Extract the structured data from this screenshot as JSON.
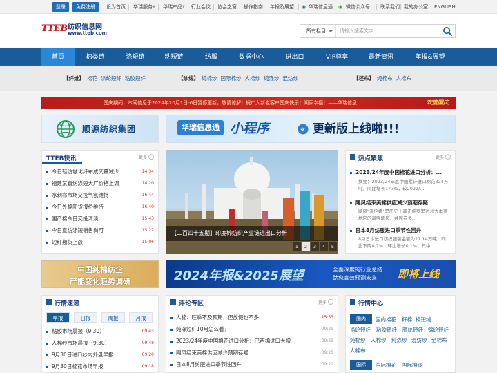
{
  "topbar": {
    "login": "登录",
    "register": "免费注册",
    "links": [
      "设为首页",
      "华瑞服务",
      "华瑞产品",
      "行业会议",
      "协会之窗",
      "操作指南",
      "年报及展望",
      "华瑞信息通",
      "微信公众号",
      "联系我们",
      "我的办公室",
      "ENGLISH"
    ]
  },
  "header": {
    "logo_mark": "TTEB",
    "logo_cn": "纺织信息网",
    "logo_url": "www.tteb.com",
    "search_category": "所有栏目",
    "search_placeholder": "请输入搜索文字"
  },
  "nav": {
    "items": [
      "首页",
      "棉类链",
      "涤短链",
      "粘短链",
      "纺服",
      "数据中心",
      "进出口",
      "VIP尊享",
      "最新资讯",
      "年报&展望"
    ]
  },
  "subnav": {
    "groups": [
      {
        "title": "【纤维】",
        "items": [
          "棉花",
          "涤纶短纤",
          "粘胶短纤"
        ]
      },
      {
        "title": "【纱线】",
        "items": [
          "纯棉纱",
          "国际棉纱",
          "人棉纱",
          "纯涤纱",
          "混纺纱"
        ]
      },
      {
        "title": "【坯布】",
        "items": [
          "纯棉布",
          "人棉布"
        ]
      }
    ]
  },
  "notice": {
    "text": "国庆期间，本网信息于2024年10月1日-6日暂停更新，敬请谅解！祝广大新老客户国庆快乐！阖家幸福！——华瑞信息",
    "badge": "欢度国庆"
  },
  "banners": {
    "shunyuan": "顺源纺织集团",
    "mini_a": "华瑞信息通",
    "mini_b": "小程序",
    "mini_c": "更新版上线啦!!!",
    "cotton_l1": "中国纯棉纺企",
    "cotton_l2": "产能变化趋势调研",
    "report_a": "2024年报&2025展望",
    "report_b1": "全面深度的行业总结",
    "report_b2": "助您高效预测未来!",
    "report_c": "即将上线"
  },
  "kuaixun": {
    "title": "TTEB快讯",
    "more": "更多",
    "items": [
      {
        "text": "今日轻纺城化纤布成交量减少",
        "time": "14:34"
      },
      {
        "text": "福建某直纺涤短大厂价格上调",
        "time": "14:20"
      },
      {
        "text": "水刺布市场交投气氛维持",
        "time": "16:44"
      },
      {
        "text": "今日外棉船货报价维持",
        "time": "16:40"
      },
      {
        "text": "国产棉今日交投清淡",
        "time": "15:43"
      },
      {
        "text": "今日直纺涤短销售尚可",
        "time": "15:22"
      },
      {
        "text": "短纤期货上涨",
        "time": "15:06"
      }
    ]
  },
  "hero": {
    "caption": "【二百四十五期】印度棉纺织产业链进出口分析",
    "pages": [
      "1",
      "2",
      "3",
      "4",
      "5"
    ],
    "active_page": "2"
  },
  "hotspot": {
    "title": "热点聚焦",
    "more": "更多",
    "items": [
      {
        "title": "2023/24年度中国棉花进口分析：...",
        "summary": "摘要：2023/24年度中国累计进口棉花324万吨，同比增长177%，较2022/..."
      },
      {
        "title": "飓风结束美棉供应减少预期存疑",
        "summary": "飓风\"海伦娜\"是历史上袭击佛罗里达州大本德地区的最强飓风，并席卷多..."
      },
      {
        "title": "日本8月纺服进口季节性回升",
        "summary": "8月日本进口纺织服装金额为21.14万吨，同比下降8.7%，环比增长0.1%；其中..."
      }
    ]
  },
  "quotes": {
    "title": "行情速递",
    "tabs": [
      "早报",
      "日报",
      "周报",
      "月报"
    ],
    "active_tab": "早报",
    "items": [
      {
        "text": "粘胶市场晨报（9.30）",
        "time": "09:43"
      },
      {
        "text": "人棉纱市场晨报（9.30）",
        "time": "09:48"
      },
      {
        "text": "9月30日进口纱内外盘早报",
        "time": "09:20"
      },
      {
        "text": "9月30日棉花市场早报",
        "time": "09:18"
      }
    ]
  },
  "comments": {
    "title": "评论专区",
    "more": "更多",
    "items": [
      {
        "text": "人棉：旺季不及预期，但放假也不多",
        "time": "15:53"
      },
      {
        "text": "纯涤短纤10月怎么看？",
        "time": "09:29"
      },
      {
        "text": "2023/24年度中国棉花进口分析：巴西棉进口大增",
        "time": "09:29"
      },
      {
        "text": "飓风结束美棉供应减少预期存疑",
        "time": "09:20"
      },
      {
        "text": "日本8月纺服进口季节性回升",
        "time": "09:20"
      }
    ]
  },
  "market_center": {
    "title": "行情中心",
    "domestic_label": "国内",
    "domestic_links": [
      "国内棉花",
      "籽棉",
      "棉短绒",
      "涤纶短纤",
      "粘胶短纤",
      "腈纶短纤",
      "锦纶短纤",
      "纯棉纱",
      "人棉纱",
      "纯涤纱",
      "混纺纱",
      "全棉布",
      "人棉布"
    ],
    "intl_label": "国际",
    "intl_links": [
      "国际棉花",
      "国际棉纱"
    ]
  }
}
